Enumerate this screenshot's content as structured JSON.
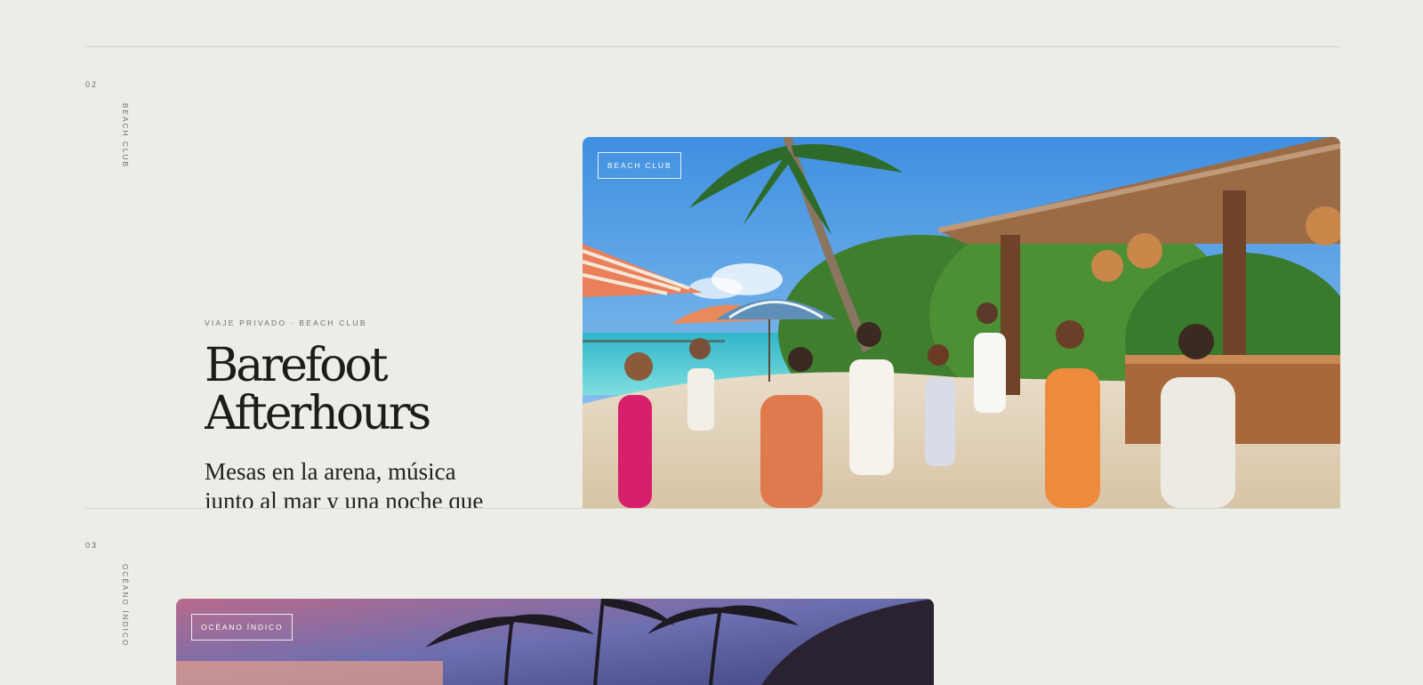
{
  "sections": [
    {
      "index": "02",
      "vertical_label": "BEACH CLUB",
      "eyebrow": "VIAJE PRIVADO · BEACH CLUB",
      "title_line1": "Barefoot",
      "title_line2": "Afterhours",
      "lede_line1": "Mesas en la arena, música",
      "lede_line2": "junto al mar y una noche que",
      "image_tag": "BEACH CLUB",
      "image_icon": "beach-party-photo"
    },
    {
      "index": "03",
      "vertical_label": "OCÉANO ÍNDICO",
      "image_tag": "OCÉANO ÍNDICO",
      "image_icon": "sunset-palms-photo"
    }
  ],
  "colors": {
    "background": "#ecede6",
    "ink": "#1b1b18",
    "muted": "#6d6f68",
    "rule": "#cfd1c9"
  }
}
